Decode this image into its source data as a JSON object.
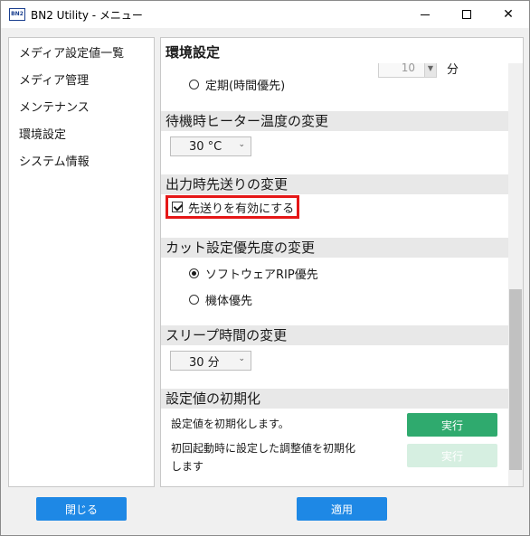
{
  "window": {
    "title": "BN2 Utility - メニュー",
    "icon_text": "BN2",
    "minimize_icon": "minimize-icon",
    "maximize_icon": "maximize-icon",
    "close_icon": "close-icon",
    "close_glyph": "✕"
  },
  "sidebar": {
    "items": [
      {
        "label": "メディア設定値一覧"
      },
      {
        "label": "メディア管理"
      },
      {
        "label": "メンテナンス"
      },
      {
        "label": "環境設定"
      },
      {
        "label": "システム情報"
      }
    ],
    "close_button": "閉じる"
  },
  "panel": {
    "title": "環境設定",
    "apply_button": "適用",
    "periodic": {
      "spinner_value": "10",
      "unit": "分",
      "radio_label": "定期(時間優先)",
      "selected": false
    },
    "standby_heater": {
      "heading": "待機時ヒーター温度の変更",
      "value": "30 °C"
    },
    "feed_on_output": {
      "heading": "出力時先送りの変更",
      "checkbox_label": "先送りを有効にする",
      "checked": true,
      "highlight_color": "#e51717"
    },
    "cut_priority": {
      "heading": "カット設定優先度の変更",
      "options": [
        {
          "label": "ソフトウェアRIP優先",
          "selected": true
        },
        {
          "label": "機体優先",
          "selected": false
        }
      ]
    },
    "sleep_time": {
      "heading": "スリープ時間の変更",
      "value": "30 分"
    },
    "reset": {
      "heading": "設定値の初期化",
      "row1_text": "設定値を初期化します。",
      "row1_button": "実行",
      "row2_text_line1": "初回起動時に設定した調整値を初期化",
      "row2_text_line2": "します",
      "row2_button": "実行",
      "row2_button_enabled": false
    }
  },
  "colors": {
    "accent_blue": "#1e88e5",
    "action_green": "#2faa6e",
    "section_header_bg": "#e8e8e8"
  }
}
